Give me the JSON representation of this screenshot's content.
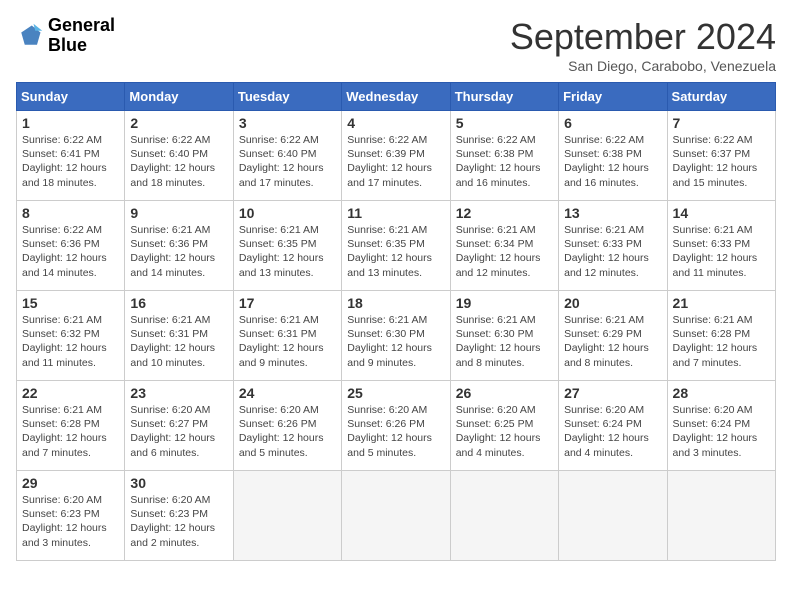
{
  "header": {
    "logo_line1": "General",
    "logo_line2": "Blue",
    "month": "September 2024",
    "location": "San Diego, Carabobo, Venezuela"
  },
  "weekdays": [
    "Sunday",
    "Monday",
    "Tuesday",
    "Wednesday",
    "Thursday",
    "Friday",
    "Saturday"
  ],
  "weeks": [
    [
      {
        "day": "1",
        "rise": "6:22 AM",
        "set": "6:41 PM",
        "hours": "12 hours and 18 minutes"
      },
      {
        "day": "2",
        "rise": "6:22 AM",
        "set": "6:40 PM",
        "hours": "12 hours and 18 minutes"
      },
      {
        "day": "3",
        "rise": "6:22 AM",
        "set": "6:40 PM",
        "hours": "12 hours and 17 minutes"
      },
      {
        "day": "4",
        "rise": "6:22 AM",
        "set": "6:39 PM",
        "hours": "12 hours and 17 minutes"
      },
      {
        "day": "5",
        "rise": "6:22 AM",
        "set": "6:38 PM",
        "hours": "12 hours and 16 minutes"
      },
      {
        "day": "6",
        "rise": "6:22 AM",
        "set": "6:38 PM",
        "hours": "12 hours and 16 minutes"
      },
      {
        "day": "7",
        "rise": "6:22 AM",
        "set": "6:37 PM",
        "hours": "12 hours and 15 minutes"
      }
    ],
    [
      {
        "day": "8",
        "rise": "6:22 AM",
        "set": "6:36 PM",
        "hours": "12 hours and 14 minutes"
      },
      {
        "day": "9",
        "rise": "6:21 AM",
        "set": "6:36 PM",
        "hours": "12 hours and 14 minutes"
      },
      {
        "day": "10",
        "rise": "6:21 AM",
        "set": "6:35 PM",
        "hours": "12 hours and 13 minutes"
      },
      {
        "day": "11",
        "rise": "6:21 AM",
        "set": "6:35 PM",
        "hours": "12 hours and 13 minutes"
      },
      {
        "day": "12",
        "rise": "6:21 AM",
        "set": "6:34 PM",
        "hours": "12 hours and 12 minutes"
      },
      {
        "day": "13",
        "rise": "6:21 AM",
        "set": "6:33 PM",
        "hours": "12 hours and 12 minutes"
      },
      {
        "day": "14",
        "rise": "6:21 AM",
        "set": "6:33 PM",
        "hours": "12 hours and 11 minutes"
      }
    ],
    [
      {
        "day": "15",
        "rise": "6:21 AM",
        "set": "6:32 PM",
        "hours": "12 hours and 11 minutes"
      },
      {
        "day": "16",
        "rise": "6:21 AM",
        "set": "6:31 PM",
        "hours": "12 hours and 10 minutes"
      },
      {
        "day": "17",
        "rise": "6:21 AM",
        "set": "6:31 PM",
        "hours": "12 hours and 9 minutes"
      },
      {
        "day": "18",
        "rise": "6:21 AM",
        "set": "6:30 PM",
        "hours": "12 hours and 9 minutes"
      },
      {
        "day": "19",
        "rise": "6:21 AM",
        "set": "6:30 PM",
        "hours": "12 hours and 8 minutes"
      },
      {
        "day": "20",
        "rise": "6:21 AM",
        "set": "6:29 PM",
        "hours": "12 hours and 8 minutes"
      },
      {
        "day": "21",
        "rise": "6:21 AM",
        "set": "6:28 PM",
        "hours": "12 hours and 7 minutes"
      }
    ],
    [
      {
        "day": "22",
        "rise": "6:21 AM",
        "set": "6:28 PM",
        "hours": "12 hours and 7 minutes"
      },
      {
        "day": "23",
        "rise": "6:20 AM",
        "set": "6:27 PM",
        "hours": "12 hours and 6 minutes"
      },
      {
        "day": "24",
        "rise": "6:20 AM",
        "set": "6:26 PM",
        "hours": "12 hours and 5 minutes"
      },
      {
        "day": "25",
        "rise": "6:20 AM",
        "set": "6:26 PM",
        "hours": "12 hours and 5 minutes"
      },
      {
        "day": "26",
        "rise": "6:20 AM",
        "set": "6:25 PM",
        "hours": "12 hours and 4 minutes"
      },
      {
        "day": "27",
        "rise": "6:20 AM",
        "set": "6:24 PM",
        "hours": "12 hours and 4 minutes"
      },
      {
        "day": "28",
        "rise": "6:20 AM",
        "set": "6:24 PM",
        "hours": "12 hours and 3 minutes"
      }
    ],
    [
      {
        "day": "29",
        "rise": "6:20 AM",
        "set": "6:23 PM",
        "hours": "12 hours and 3 minutes"
      },
      {
        "day": "30",
        "rise": "6:20 AM",
        "set": "6:23 PM",
        "hours": "12 hours and 2 minutes"
      },
      null,
      null,
      null,
      null,
      null
    ]
  ]
}
